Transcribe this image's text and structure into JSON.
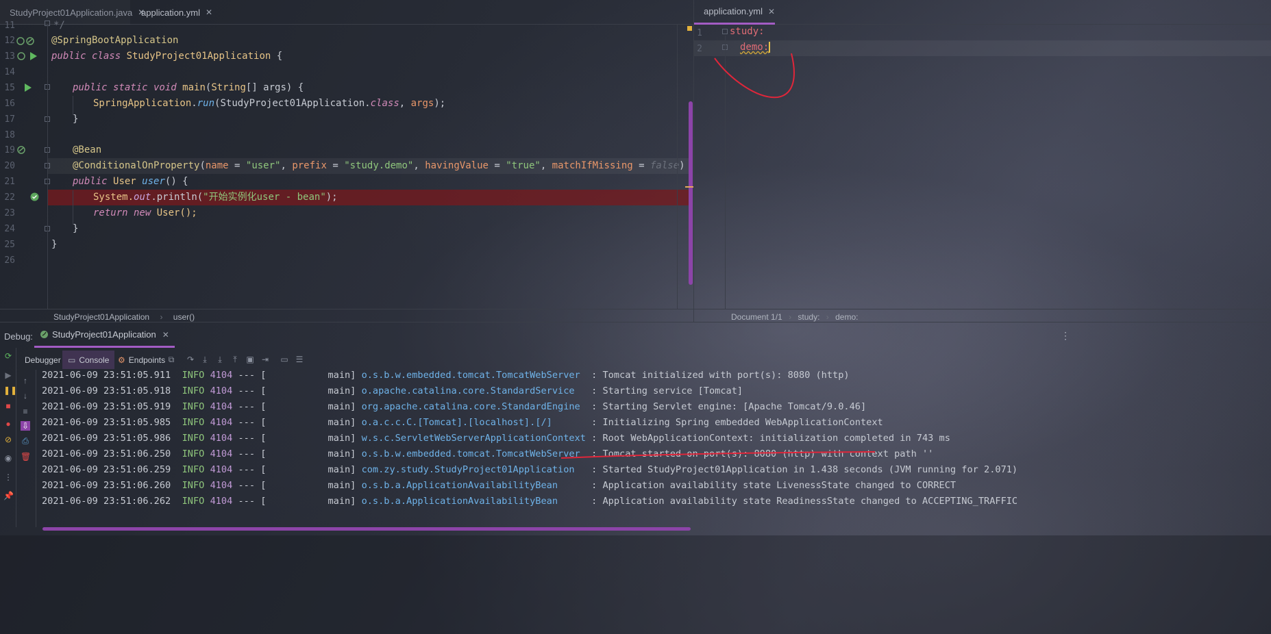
{
  "editor_left": {
    "tabs": [
      {
        "label": "StudyProject01Application.java",
        "icon": "java-class-icon"
      },
      {
        "label": "application.yml",
        "icon": "yaml-file-icon"
      }
    ],
    "line_numbers": [
      "11",
      "12",
      "13",
      "14",
      "15",
      "16",
      "17",
      "18",
      "19",
      "20",
      "21",
      "22",
      "23",
      "24",
      "25",
      "26"
    ],
    "lines": {
      "l11": "*/",
      "l12_ann": "@SpringBootApplication",
      "l13_kw": "public class ",
      "l13_name": "StudyProject01Application",
      "l13_end": " {",
      "l15_kw": "public static void ",
      "l15_name": "main",
      "l15_a": "(",
      "l15_type": "String",
      "l15_b": "[] args) {",
      "l16_cls": "SpringApplication",
      "l16_dot": ".",
      "l16_meth": "run",
      "l16_a": "(StudyProject01Application.",
      "l16_kw": "class",
      "l16_b": ", ",
      "l16_arg": "args",
      "l16_c": ");",
      "l17": "}",
      "l19_ann": "@Bean",
      "l20_ann": "@ConditionalOnProperty",
      "l20_a": "(",
      "l20_p1": "name",
      "l20_eq1": " = ",
      "l20_s1": "\"user\"",
      "l20_c1": ", ",
      "l20_p2": "prefix",
      "l20_eq2": " = ",
      "l20_s2": "\"study.demo\"",
      "l20_c2": ", ",
      "l20_p3": "havingValue",
      "l20_eq3": " = ",
      "l20_s3": "\"true\"",
      "l20_c3": ", ",
      "l20_p4": "matchIfMissing",
      "l20_eq4": " = ",
      "l20_v4": "false",
      "l20_end": ")",
      "l21_kw": "public ",
      "l21_type": "User ",
      "l21_name": "user",
      "l21_end": "() {",
      "l22_cls": "System.",
      "l22_field": "out",
      "l22_a": ".println(",
      "l22_str": "\"开始实例化user - bean\"",
      "l22_end": ");",
      "l23_kw": "return new ",
      "l23_end": "User();",
      "l24": "}",
      "l25": "}"
    },
    "breadcrumb": [
      "StudyProject01Application",
      "user()"
    ]
  },
  "editor_right": {
    "tab": {
      "label": "application.yml",
      "icon": "yaml-file-icon"
    },
    "line_numbers": [
      "1",
      "2"
    ],
    "lines": {
      "l1": "study:",
      "l2": "demo:"
    },
    "breadcrumb": [
      "Document 1/1",
      "study:",
      "demo:"
    ]
  },
  "debug": {
    "label": "Debug:",
    "session": "StudyProject01Application",
    "tabs": [
      "Debugger",
      "Console",
      "Endpoints"
    ],
    "active_tab": "Console",
    "log": [
      {
        "ts": "2021-06-09 23:51:05.911",
        "level": "INFO",
        "pid": "4104",
        "sep": " --- [",
        "thread": "           main] ",
        "logger": "o.s.b.w.embedded.tomcat.TomcatWebServer  ",
        "msg": ": Tomcat initialized with port(s): 8080 (http)"
      },
      {
        "ts": "2021-06-09 23:51:05.918",
        "level": "INFO",
        "pid": "4104",
        "sep": " --- [",
        "thread": "           main] ",
        "logger": "o.apache.catalina.core.StandardService   ",
        "msg": ": Starting service [Tomcat]"
      },
      {
        "ts": "2021-06-09 23:51:05.919",
        "level": "INFO",
        "pid": "4104",
        "sep": " --- [",
        "thread": "           main] ",
        "logger": "org.apache.catalina.core.StandardEngine  ",
        "msg": ": Starting Servlet engine: [Apache Tomcat/9.0.46]"
      },
      {
        "ts": "2021-06-09 23:51:05.985",
        "level": "INFO",
        "pid": "4104",
        "sep": " --- [",
        "thread": "           main] ",
        "logger": "o.a.c.c.C.[Tomcat].[localhost].[/]       ",
        "msg": ": Initializing Spring embedded WebApplicationContext"
      },
      {
        "ts": "2021-06-09 23:51:05.986",
        "level": "INFO",
        "pid": "4104",
        "sep": " --- [",
        "thread": "           main] ",
        "logger": "w.s.c.ServletWebServerApplicationContext ",
        "msg": ": Root WebApplicationContext: initialization completed in 743 ms"
      },
      {
        "ts": "2021-06-09 23:51:06.250",
        "level": "INFO",
        "pid": "4104",
        "sep": " --- [",
        "thread": "           main] ",
        "logger": "o.s.b.w.embedded.tomcat.TomcatWebServer  ",
        "msg": ": Tomcat started on port(s): 8080 (http) with context path ''"
      },
      {
        "ts": "2021-06-09 23:51:06.259",
        "level": "INFO",
        "pid": "4104",
        "sep": " --- [",
        "thread": "           main] ",
        "logger": "com.zy.study.StudyProject01Application   ",
        "msg": ": Started StudyProject01Application in 1.438 seconds (JVM running for 2.071)"
      },
      {
        "ts": "2021-06-09 23:51:06.260",
        "level": "INFO",
        "pid": "4104",
        "sep": " --- [",
        "thread": "           main] ",
        "logger": "o.s.b.a.ApplicationAvailabilityBean      ",
        "msg": ": Application availability state LivenessState changed to CORRECT"
      },
      {
        "ts": "2021-06-09 23:51:06.262",
        "level": "INFO",
        "pid": "4104",
        "sep": " --- [",
        "thread": "           main] ",
        "logger": "o.s.b.a.ApplicationAvailabilityBean      ",
        "msg": ": Application availability state ReadinessState changed to ACCEPTING_TRAFFIC"
      }
    ]
  },
  "colors": {
    "accent": "#a35cc4",
    "breakpoint_line": "#5a1f22",
    "annotation_red": "#e0263a"
  }
}
